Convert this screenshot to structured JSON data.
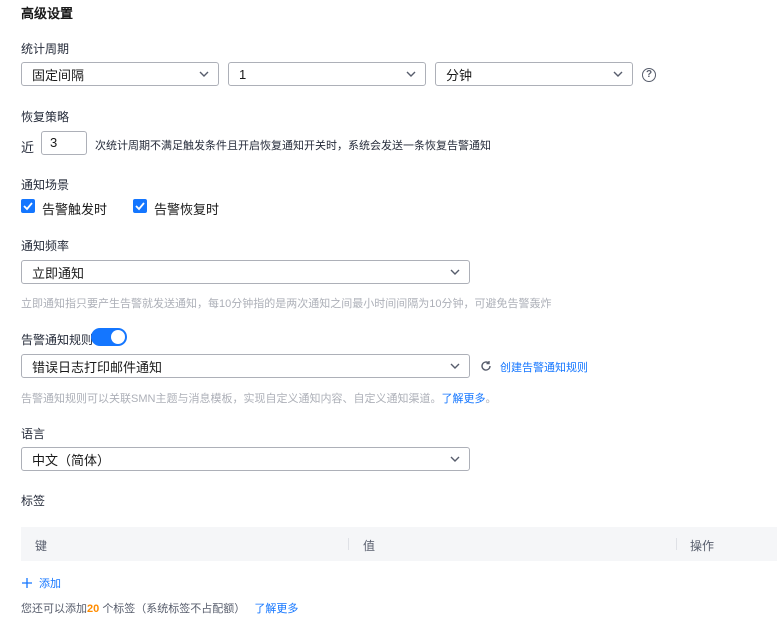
{
  "section": {
    "title": "高级设置"
  },
  "period": {
    "label": "统计周期",
    "type_value": "固定间隔",
    "count_value": "1",
    "unit_value": "分钟",
    "help_icon": "question-circle-icon"
  },
  "recovery": {
    "label": "恢复策略",
    "prefix": "近",
    "count": "3",
    "description": "次统计周期不满足触发条件且开启恢复通知开关时，系统会发送一条恢复告警通知"
  },
  "scenario": {
    "label": "通知场景",
    "options": [
      {
        "label": "告警触发时",
        "checked": true
      },
      {
        "label": "告警恢复时",
        "checked": true
      }
    ]
  },
  "frequency": {
    "label": "通知频率",
    "value": "立即通知",
    "hint": "立即通知指只要产生告警就发送通知，每10分钟指的是两次通知之间最小时间间隔为10分钟，可避免告警轰炸"
  },
  "rule": {
    "label": "告警通知规则",
    "enabled": true,
    "value": "错误日志打印邮件通知",
    "create_link": "创建告警通知规则",
    "hint": "告警通知规则可以关联SMN主题与消息模板，实现自定义通知内容、自定义通知渠道。",
    "learn_more": "了解更多",
    "hint_suffix": "。"
  },
  "language": {
    "label": "语言",
    "value": "中文（简体）"
  },
  "tags": {
    "label": "标签",
    "columns": [
      "键",
      "值",
      "操作"
    ],
    "add_label": "添加",
    "footer_prefix": "您还可以添加",
    "remaining": "20",
    "footer_suffix": "个标签（系统标签不占配额）",
    "learn_more": "了解更多"
  },
  "colors": {
    "accent": "#1476ff",
    "highlight": "#ff8c00"
  }
}
